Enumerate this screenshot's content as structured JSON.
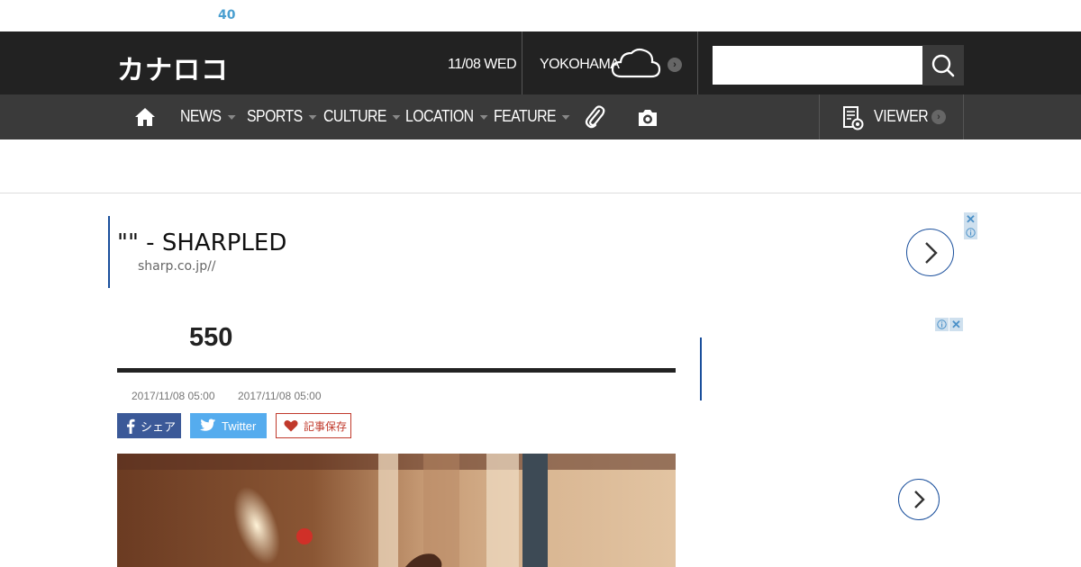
{
  "topbar": {
    "count": "40"
  },
  "header": {
    "logo": "カナロコ",
    "date": "11/08 WED",
    "city": "YOKOHAMA",
    "weather_icon": "cloud-icon",
    "search": {
      "value": "",
      "placeholder": ""
    }
  },
  "nav": {
    "items": [
      {
        "label": "NEWS"
      },
      {
        "label": "SPORTS"
      },
      {
        "label": "CULTURE"
      },
      {
        "label": "LOCATION"
      },
      {
        "label": "FEATURE"
      }
    ],
    "viewer_label": "VIEWER"
  },
  "ad_top": {
    "title": "\"\" - SHARPLED",
    "url": "sharp.co.jp//"
  },
  "article": {
    "headline": "550",
    "published": "2017/11/08 05:00",
    "updated": "2017/11/08 05:00",
    "share": {
      "facebook": "シェア",
      "twitter": "Twitter",
      "save": "記事保存"
    }
  },
  "colors": {
    "header_bg": "#222222",
    "nav_bg": "#3a3a3a",
    "accent_blue": "#1a4f9c",
    "facebook": "#3b5998",
    "twitter": "#55acee",
    "save_red": "#c0392b"
  }
}
